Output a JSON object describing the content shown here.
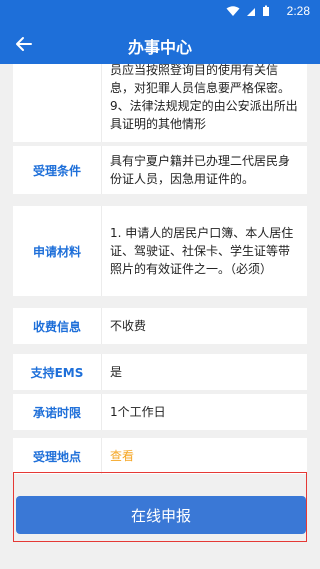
{
  "status": {
    "time": "2:28"
  },
  "header": {
    "title": "办事中心"
  },
  "rows": {
    "top_text": "员应当按照登询目的使用有关信息，对犯罪人员信息要严格保密。    9、法律法规规定的由公安派出所出具证明的其他情形",
    "conditions": {
      "label": "受理条件",
      "value": "具有宁夏户籍并已办理二代居民身份证人员，因急用证件的。"
    },
    "materials": {
      "label": "申请材料",
      "value": "1. 申请人的居民户口簿、本人居住证、驾驶证、社保卡、学生证等带照片的有效证件之一。（必须）"
    },
    "fee": {
      "label": "收费信息",
      "value": "不收费"
    },
    "ems": {
      "label": "支持EMS",
      "value": "是"
    },
    "time_limit": {
      "label": "承诺时限",
      "value": "1个工作日"
    },
    "location": {
      "label": "受理地点",
      "value": "查看"
    }
  },
  "footer": {
    "button": "在线申报"
  },
  "colors": {
    "primary": "#1e6fd9",
    "link": "#f5a623",
    "highlight": "#e53935"
  }
}
